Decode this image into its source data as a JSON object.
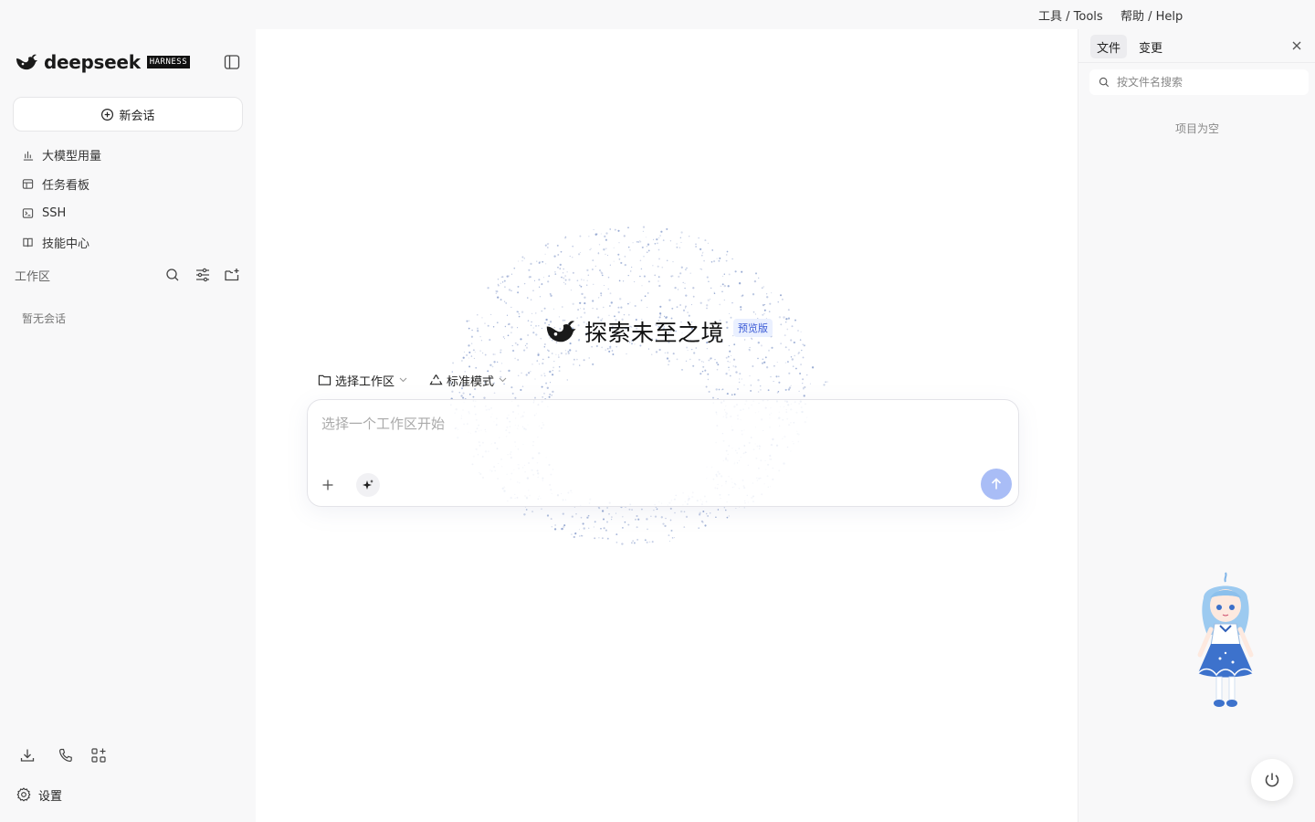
{
  "menubar": {
    "tools": "工具 / Tools",
    "help": "帮助 / Help"
  },
  "sidebar": {
    "brand_name": "deepseek",
    "brand_badge": "HARNESS",
    "new_chat_label": "新会话",
    "nav_items": [
      {
        "label": "大模型用量",
        "icon": "bar-chart-icon"
      },
      {
        "label": "任务看板",
        "icon": "board-icon"
      },
      {
        "label": "SSH",
        "icon": "terminal-icon"
      },
      {
        "label": "技能中心",
        "icon": "book-icon"
      }
    ],
    "workspace_title": "工作区",
    "empty_sessions": "暂无会话",
    "settings_label": "设置"
  },
  "main": {
    "hero_title": "探索未至之境",
    "preview_badge": "预览版",
    "workspace_selector": "选择工作区",
    "mode_selector": "标准模式",
    "input_placeholder": "选择一个工作区开始"
  },
  "right_panel": {
    "tabs": [
      {
        "label": "文件",
        "active": true
      },
      {
        "label": "变更",
        "active": false
      }
    ],
    "search_placeholder": "按文件名搜索",
    "empty_text": "项目为空"
  },
  "colors": {
    "accent": "#a9bdf6",
    "badge_bg": "#eaf0ff",
    "badge_text": "#3b5bd6",
    "panel_bg": "#f8f8f9"
  }
}
